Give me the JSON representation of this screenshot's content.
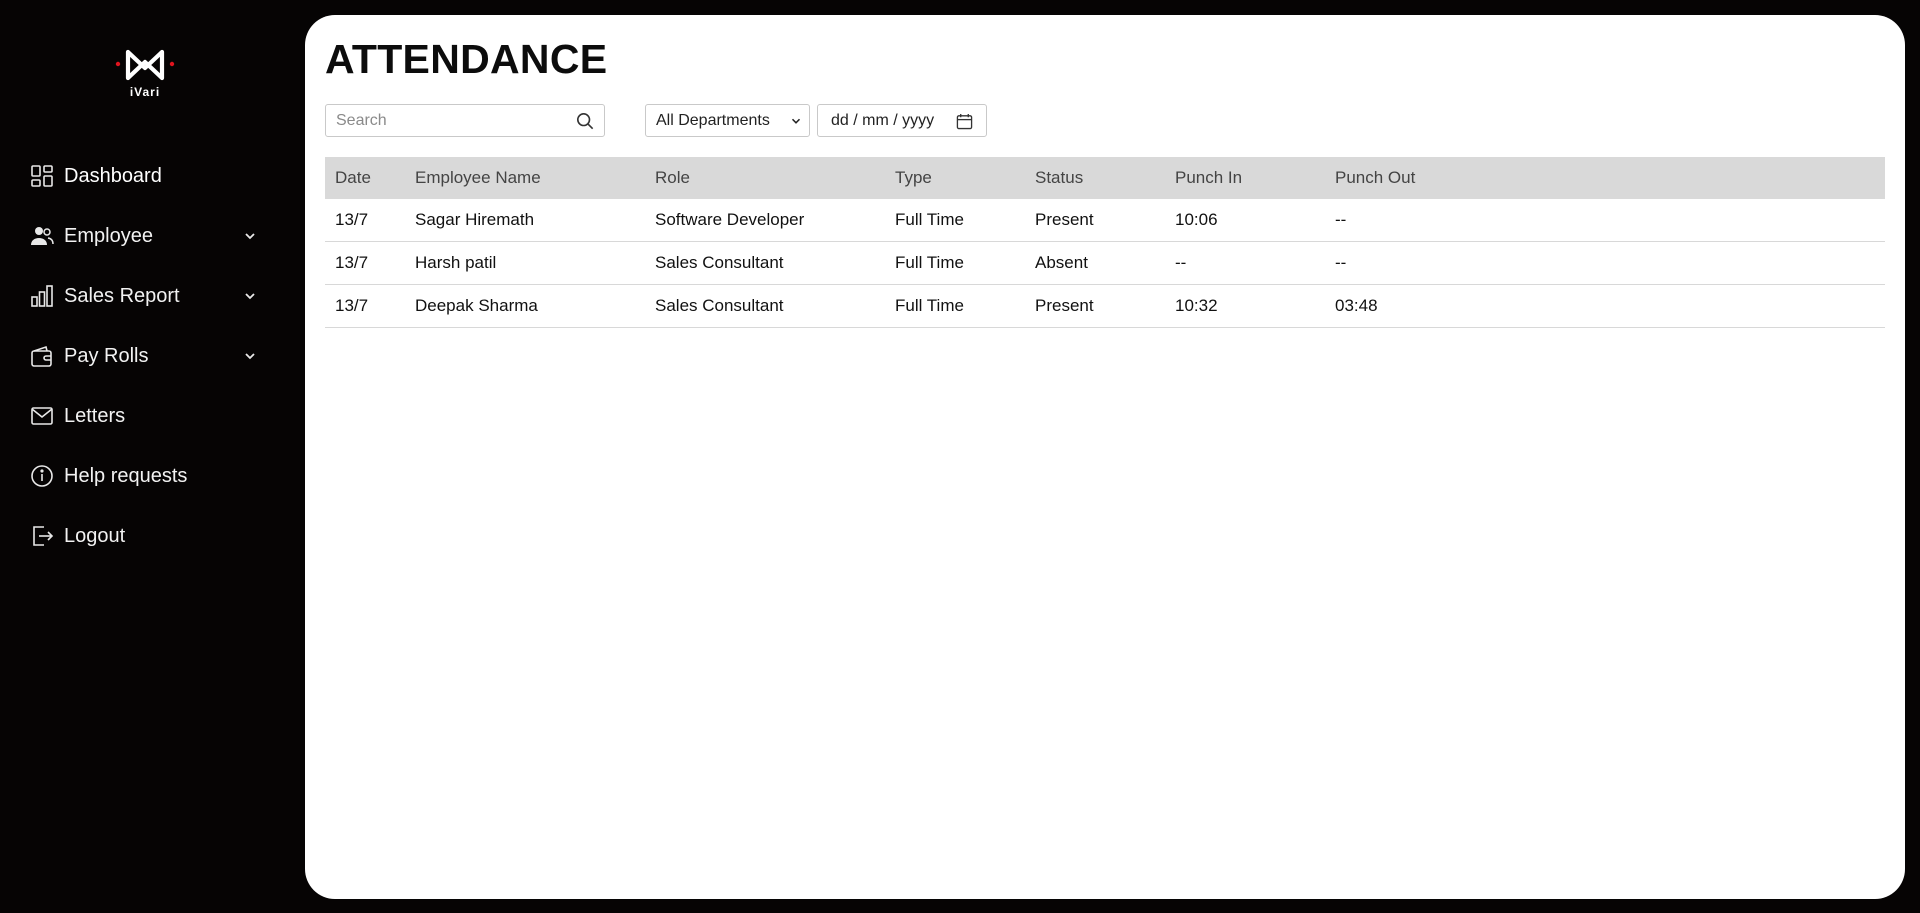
{
  "brand": {
    "logo_text": "iVari",
    "accent_color": "#e0141e"
  },
  "sidebar": {
    "items": [
      {
        "label": "Dashboard",
        "icon": "dashboard-icon",
        "has_submenu": false
      },
      {
        "label": "Employee",
        "icon": "users-icon",
        "has_submenu": true
      },
      {
        "label": "Sales Report",
        "icon": "bar-chart-icon",
        "has_submenu": true
      },
      {
        "label": "Pay Rolls",
        "icon": "wallet-icon",
        "has_submenu": true
      },
      {
        "label": "Letters",
        "icon": "mail-icon",
        "has_submenu": false
      },
      {
        "label": "Help requests",
        "icon": "info-icon",
        "has_submenu": false
      },
      {
        "label": "Logout",
        "icon": "logout-icon",
        "has_submenu": false
      }
    ]
  },
  "page": {
    "title": "ATTENDANCE"
  },
  "filters": {
    "search_placeholder": "Search",
    "department_selected": "All Departments",
    "date_placeholder": "dd / mm / yyyy"
  },
  "table": {
    "headers": [
      "Date",
      "Employee Name",
      "Role",
      "Type",
      "Status",
      "Punch In",
      "Punch Out"
    ],
    "rows": [
      [
        "13/7",
        "Sagar Hiremath",
        "Software Developer",
        "Full Time",
        "Present",
        "10:06",
        "--"
      ],
      [
        "13/7",
        "Harsh patil",
        "Sales Consultant",
        "Full Time",
        "Absent",
        "--",
        "--"
      ],
      [
        "13/7",
        "Deepak Sharma",
        "Sales Consultant",
        "Full Time",
        "Present",
        "10:32",
        "03:48"
      ]
    ]
  }
}
